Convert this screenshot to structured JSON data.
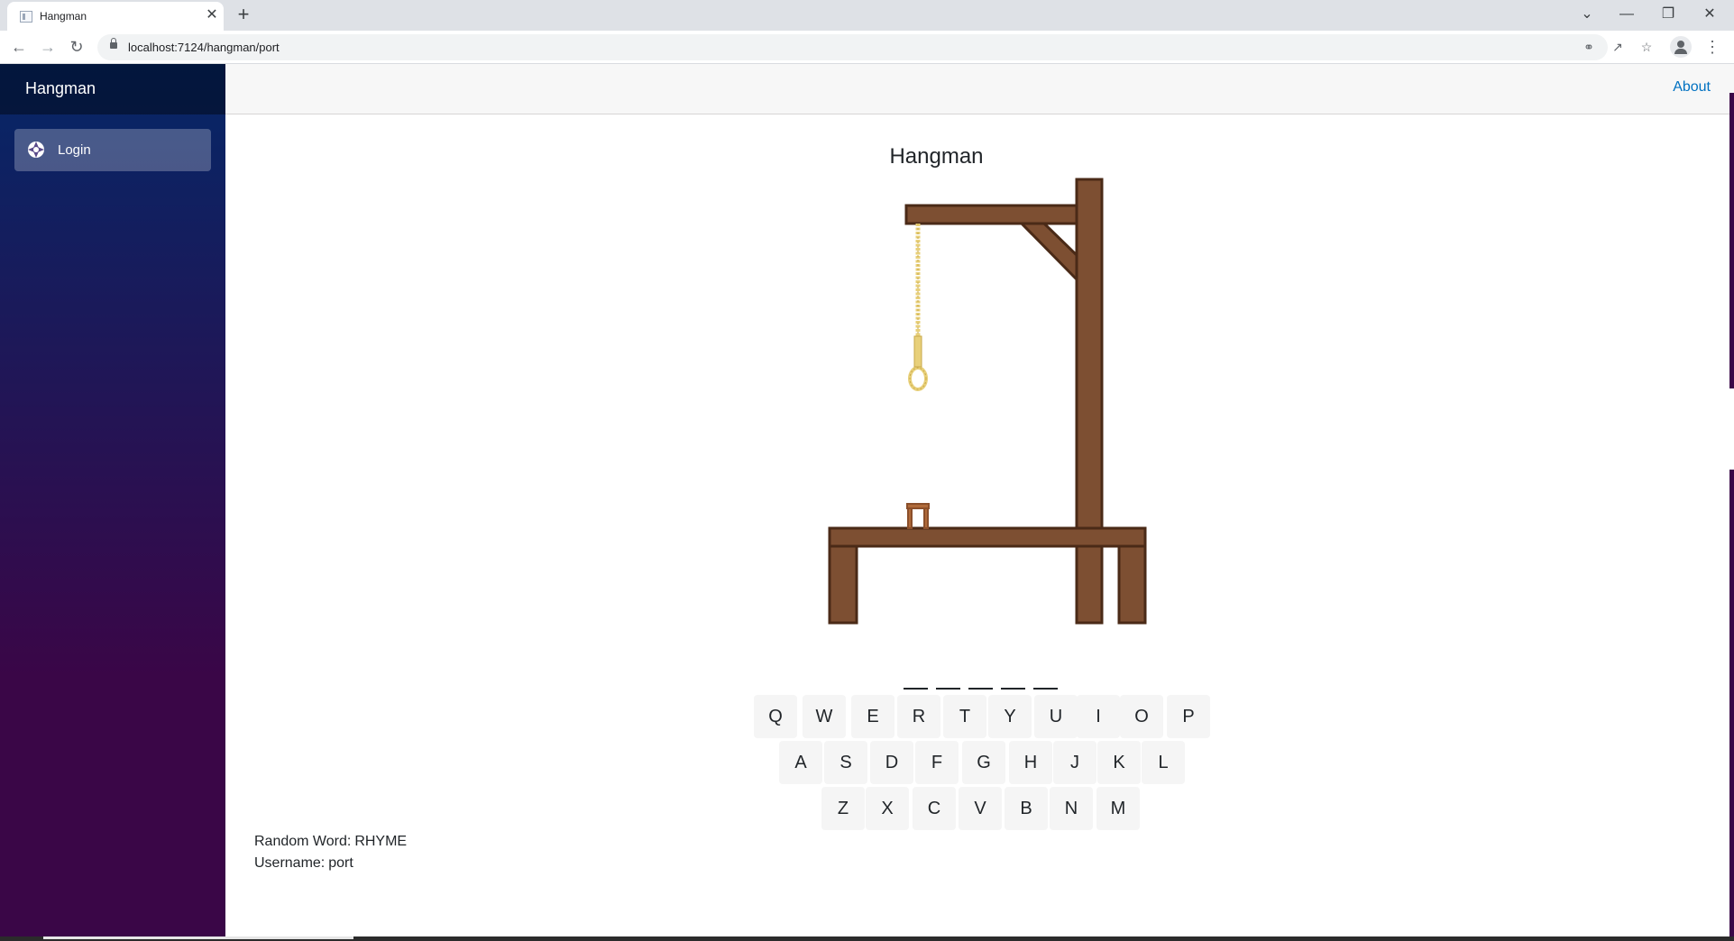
{
  "browser": {
    "tab_title": "Hangman",
    "tab_close": "✕",
    "new_tab": "+",
    "url": "localhost:7124/hangman/port",
    "window_controls": {
      "dropdown": "⌄",
      "minimize": "—",
      "restore": "❐",
      "close": "✕"
    },
    "icons": [
      "back-icon",
      "forward-icon",
      "reload-icon",
      "lock-icon",
      "key-icon",
      "share-icon",
      "star-icon",
      "profile-icon",
      "menu-icon"
    ]
  },
  "sidebar": {
    "brand": "Hangman",
    "items": [
      {
        "label": "Login",
        "icon": "login-icon"
      }
    ]
  },
  "topbar": {
    "about_label": "About"
  },
  "game": {
    "title": "Hangman",
    "word_length": 5,
    "keyboard": {
      "rows": [
        [
          "Q",
          "W",
          "E",
          "R",
          "T",
          "Y",
          "U",
          "I",
          "O",
          "P"
        ],
        [
          "A",
          "S",
          "D",
          "F",
          "G",
          "H",
          "J",
          "K",
          "L"
        ],
        [
          "Z",
          "X",
          "C",
          "V",
          "B",
          "N",
          "M"
        ]
      ]
    },
    "info": {
      "random_word_label": "Random Word:",
      "random_word_value": "RHYME",
      "username_label": "Username:",
      "username_value": "port"
    }
  },
  "colors": {
    "sidebar_top": "#052767",
    "sidebar_bottom": "#3a0647",
    "wood": "#7d4f32",
    "wood_outline": "#4a2a17",
    "rope": "#e8d07a",
    "link": "#0071c1",
    "key_bg": "#f5f5f5"
  }
}
